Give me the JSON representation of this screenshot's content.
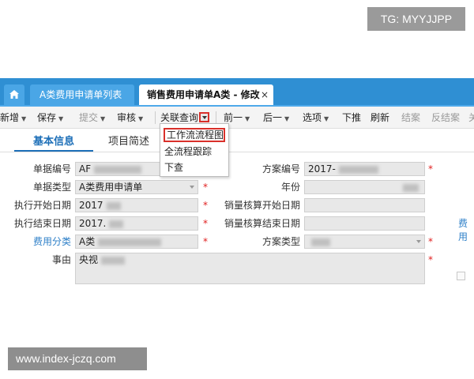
{
  "watermarks": {
    "top": "TG: MYYJJPP",
    "bottom": "www.index-jczq.com"
  },
  "tabs": {
    "home_icon": "home-icon",
    "list_label": "A类费用申请单列表",
    "active_label": "销售费用申请单A类 - 修改",
    "close_glyph": "×"
  },
  "toolbar": {
    "new": "新增",
    "save": "保存",
    "submit": "提交",
    "review": "审核",
    "related_query": "关联查询",
    "prev": "前一",
    "next": "后一",
    "options": "选项",
    "push_down": "下推",
    "refresh": "刷新",
    "close_case": "结案",
    "reverse_close": "反结案",
    "truncated": "关"
  },
  "dropdown": {
    "items": [
      "工作流流程图",
      "全流程跟踪",
      "下查"
    ],
    "highlighted_index": 0
  },
  "form_tabs": {
    "basic": "基本信息",
    "project": "项目简述"
  },
  "form": {
    "doc_no_label": "单据编号",
    "doc_no_value": "AF",
    "doc_type_label": "单据类型",
    "doc_type_value": "A类费用申请单",
    "exec_start_label": "执行开始日期",
    "exec_start_value": "2017",
    "exec_end_label": "执行结束日期",
    "exec_end_value": "2017.",
    "fee_class_label": "费用分类",
    "fee_class_value": "A类",
    "reason_label": "事由",
    "reason_value": "央视",
    "plan_no_label": "方案编号",
    "plan_no_value": "2017-",
    "year_label": "年份",
    "sales_start_label": "销量核算开始日期",
    "sales_end_label": "销量核算结束日期",
    "plan_type_label": "方案类型",
    "required_mark": "*",
    "side_link": "费用"
  },
  "colors": {
    "tab_bar": "#2f8fd3",
    "accent": "#1d6fb8",
    "highlight_border": "#d9302a",
    "required": "#e02020"
  }
}
